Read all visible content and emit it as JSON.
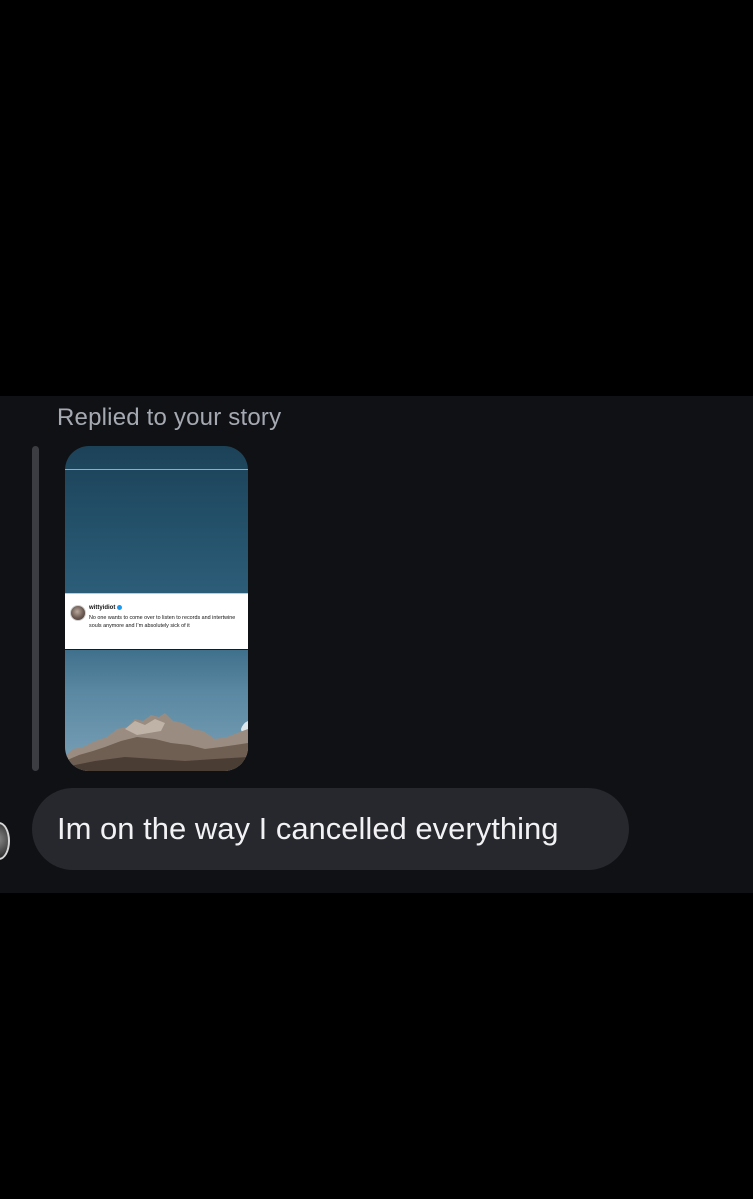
{
  "chat": {
    "reply_label": "Replied to your story",
    "story": {
      "tweet": {
        "handle": "wittyidiot",
        "text": "No one wants to come over to listen to records and intertwine souls anymore and I'm absolutely sick of it"
      }
    },
    "message": {
      "text": "Im on the way I cancelled everything"
    },
    "avatar_icon": "user-avatar"
  },
  "colors": {
    "background": "#000000",
    "chat_band": "#0f1115",
    "bubble": "#26282d",
    "reply_label": "#a5a9b1",
    "message_text": "#f2f2f4",
    "verified": "#1d9bf0"
  }
}
